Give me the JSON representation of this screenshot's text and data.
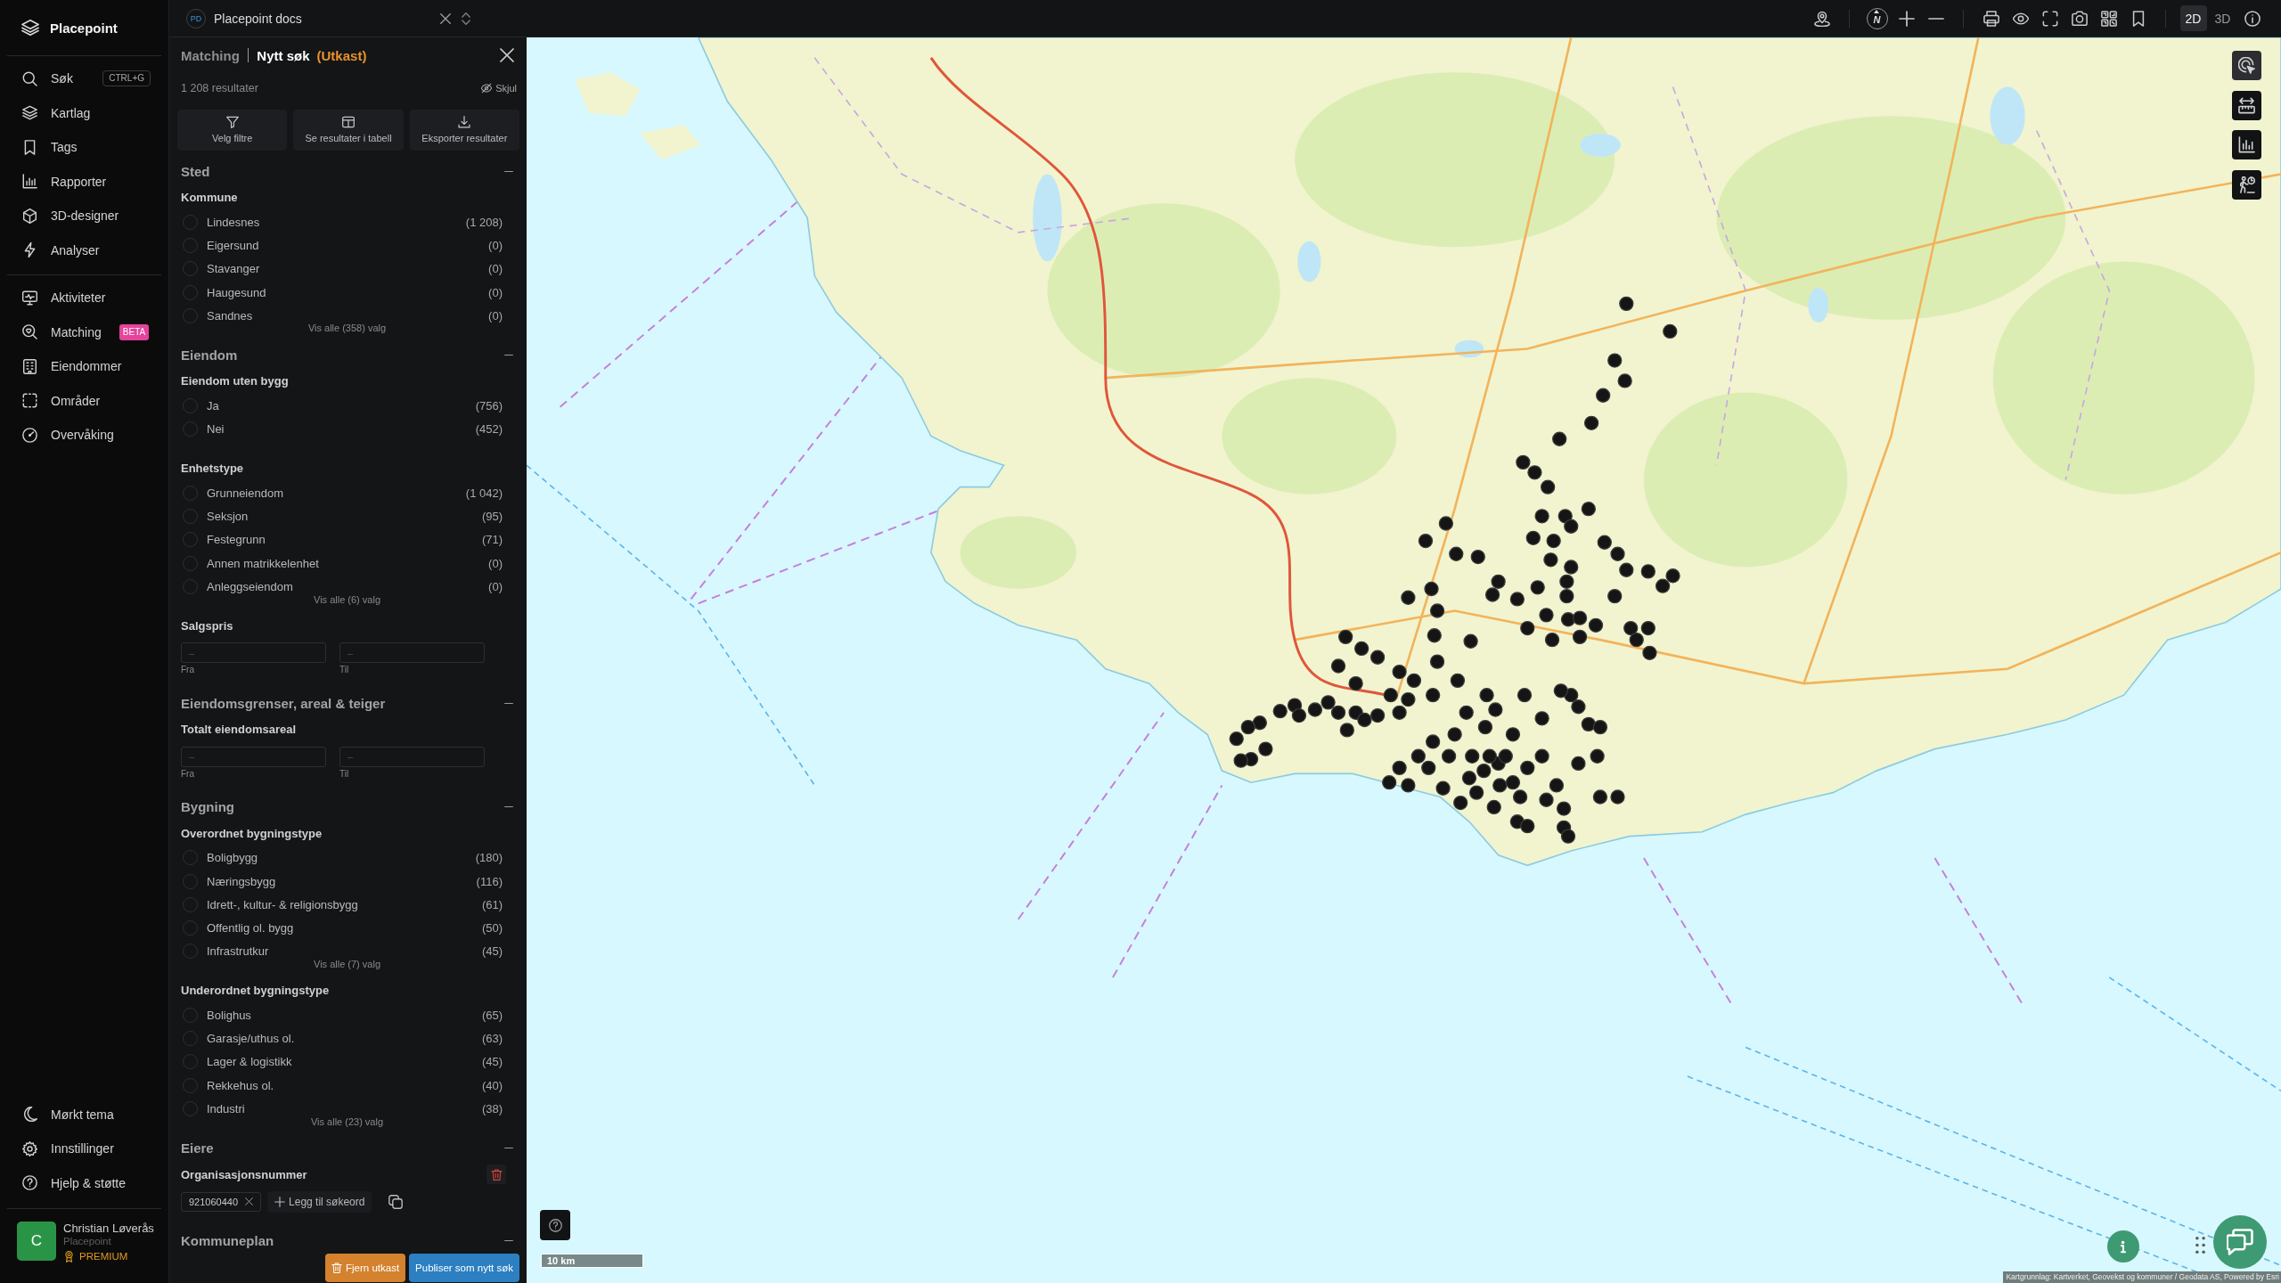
{
  "sidebar": {
    "brand": "Placepoint",
    "groups": [
      {
        "items": [
          {
            "label": "Søk",
            "shortcut": "CTRL+G"
          },
          {
            "label": "Kartlag"
          },
          {
            "label": "Tags"
          },
          {
            "label": "Rapporter"
          },
          {
            "label": "3D-designer"
          },
          {
            "label": "Analyser"
          }
        ]
      },
      {
        "items": [
          {
            "label": "Aktiviteter"
          },
          {
            "label": "Matching",
            "badge": "BETA"
          },
          {
            "label": "Eiendommer"
          },
          {
            "label": "Områder"
          },
          {
            "label": "Overvåking"
          }
        ]
      }
    ],
    "bottom_items": [
      {
        "label": "Mørkt tema"
      },
      {
        "label": "Innstillinger"
      },
      {
        "label": "Hjelp & støtte"
      }
    ],
    "user": {
      "initial": "C",
      "name": "Christian Løverås",
      "organization": "Placepoint",
      "plan": "PREMIUM"
    }
  },
  "topbar": {
    "workspace": {
      "initials": "PD",
      "title": "Placepoint docs"
    },
    "compass": "N",
    "view_modes": [
      {
        "label": "2D",
        "selected": true
      },
      {
        "label": "3D",
        "selected": false
      }
    ]
  },
  "panel": {
    "breadcrumb": "Matching",
    "title": "Nytt søk",
    "status": "(Utkast)",
    "result_count": "1 208 resultater",
    "hide_label": "Skjul",
    "actions": [
      {
        "label": "Velg filtre"
      },
      {
        "label": "Se resultater i tabell"
      },
      {
        "label": "Eksporter resultater"
      }
    ],
    "sections": [
      {
        "title": "Sted",
        "expanded": true,
        "groups": [
          {
            "kind": "options",
            "title": "Kommune",
            "options": [
              {
                "label": "Lindesnes",
                "count": "(1 208)",
                "checked": false
              },
              {
                "label": "Eigersund",
                "count": "(0)",
                "checked": false
              },
              {
                "label": "Stavanger",
                "count": "(0)",
                "checked": false
              },
              {
                "label": "Haugesund",
                "count": "(0)",
                "checked": false
              },
              {
                "label": "Sandnes",
                "count": "(0)",
                "checked": false
              }
            ],
            "show_all": "Vis alle (358) valg"
          }
        ]
      },
      {
        "title": "Eiendom",
        "expanded": true,
        "groups": [
          {
            "kind": "options",
            "title": "Eiendom uten bygg",
            "options": [
              {
                "label": "Ja",
                "count": "(756)",
                "checked": false
              },
              {
                "label": "Nei",
                "count": "(452)",
                "checked": false
              }
            ]
          },
          {
            "kind": "options",
            "title": "Enhetstype",
            "options": [
              {
                "label": "Grunneiendom",
                "count": "(1 042)",
                "checked": false
              },
              {
                "label": "Seksjon",
                "count": "(95)",
                "checked": false
              },
              {
                "label": "Festegrunn",
                "count": "(71)",
                "checked": false
              },
              {
                "label": "Annen matrikkelenhet",
                "count": "(0)",
                "checked": false
              },
              {
                "label": "Anleggseiendom",
                "count": "(0)",
                "checked": false
              }
            ],
            "show_all": "Vis alle (6) valg"
          },
          {
            "kind": "range",
            "title": "Salgspris",
            "fields": [
              {
                "placeholder": "–",
                "caption": "Fra"
              },
              {
                "placeholder": "–",
                "caption": "Til"
              }
            ]
          }
        ]
      },
      {
        "title": "Eiendomsgrenser, areal & teiger",
        "expanded": true,
        "groups": [
          {
            "kind": "range",
            "title": "Totalt eiendomsareal",
            "fields": [
              {
                "placeholder": "–",
                "caption": "Fra"
              },
              {
                "placeholder": "–",
                "caption": "Til"
              }
            ]
          }
        ]
      },
      {
        "title": "Bygning",
        "expanded": true,
        "groups": [
          {
            "kind": "options",
            "title": "Overordnet bygningstype",
            "options": [
              {
                "label": "Boligbygg",
                "count": "(180)",
                "checked": false
              },
              {
                "label": "Næringsbygg",
                "count": "(116)",
                "checked": false
              },
              {
                "label": "Idrett-, kultur- & religionsbygg",
                "count": "(61)",
                "checked": false
              },
              {
                "label": "Offentlig ol. bygg",
                "count": "(50)",
                "checked": false
              },
              {
                "label": "Infrastrutkur",
                "count": "(45)",
                "checked": false
              }
            ],
            "show_all": "Vis alle (7) valg"
          },
          {
            "kind": "options",
            "title": "Underordnet bygningstype",
            "options": [
              {
                "label": "Bolighus",
                "count": "(65)",
                "checked": false
              },
              {
                "label": "Garasje/uthus ol.",
                "count": "(63)",
                "checked": false
              },
              {
                "label": "Lager & logistikk",
                "count": "(45)",
                "checked": false
              },
              {
                "label": "Rekkehus ol.",
                "count": "(40)",
                "checked": false
              },
              {
                "label": "Industri",
                "count": "(38)",
                "checked": false
              }
            ],
            "show_all": "Vis alle (23) valg"
          }
        ]
      },
      {
        "title": "Eiere",
        "expanded": true,
        "groups": [
          {
            "kind": "keywords",
            "title": "Organisasjonsnummer",
            "keywords": [
              {
                "label": "921060440"
              }
            ],
            "add_label": "Legg til søkeord"
          }
        ]
      },
      {
        "title": "Kommuneplan",
        "expanded": true
      }
    ],
    "footer_buttons": [
      {
        "kind": "danger",
        "label": "Fjern utkast"
      },
      {
        "kind": "primary",
        "label": "Publiser som nytt søk"
      }
    ]
  },
  "map": {
    "tools": [
      {
        "selected": true
      },
      {
        "selected": false
      },
      {
        "selected": false
      },
      {
        "selected": false
      }
    ],
    "scale": "10 km",
    "attribution": "Kartgrunnlag: Kartverket, Geovekst og kommuner / Geodata AS, Powered by Esri"
  }
}
